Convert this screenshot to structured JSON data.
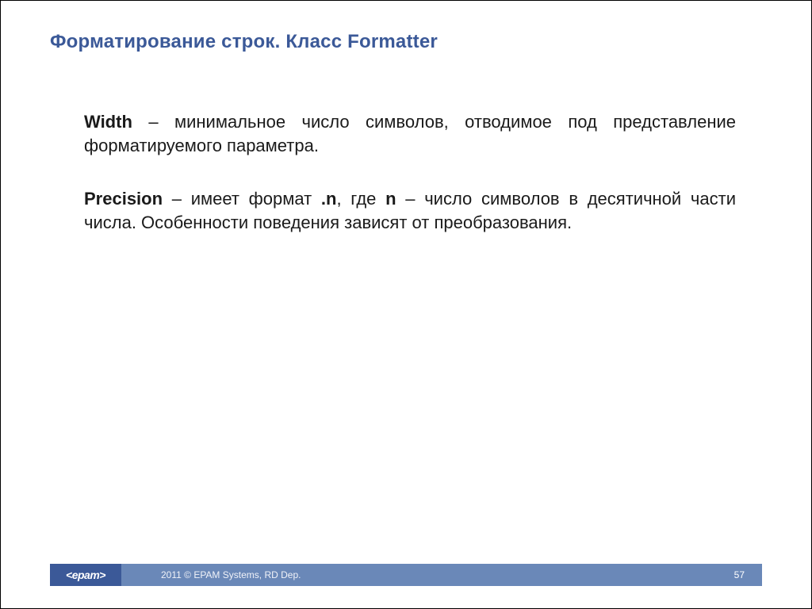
{
  "title": "Форматирование строк. Класс Formatter",
  "content": {
    "p1": {
      "bold": "Width",
      "rest": " – минимальное число символов, отводимое под представление форматируемого параметра."
    },
    "p2": {
      "s1b": "Precision",
      "s2": " – имеет формат ",
      "s3b": ".n",
      "s4": ", где ",
      "s5b": "n",
      "s6": " – число символов в десятичной части числа. Особенности поведения зависят от преобразования."
    }
  },
  "footer": {
    "logo": "<epam>",
    "copy": "2011 © EPAM Systems, RD Dep.",
    "page": "57"
  }
}
